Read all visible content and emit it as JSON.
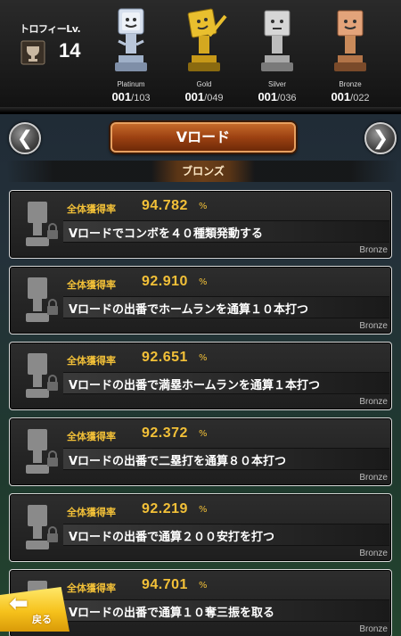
{
  "header": {
    "level_label": "トロフィーLv.",
    "level_value": "14",
    "trophies": [
      {
        "name": "Platinum",
        "got": "001",
        "total": "/103",
        "color": "#9fb3d6"
      },
      {
        "name": "Gold",
        "got": "001",
        "total": "/049",
        "color": "#e3b92a"
      },
      {
        "name": "Silver",
        "got": "001",
        "total": "/036",
        "color": "#c8c8c8"
      },
      {
        "name": "Bronze",
        "got": "001",
        "total": "/022",
        "color": "#c98a5a"
      }
    ]
  },
  "nav": {
    "prev_icon": "chevron-left-icon",
    "next_icon": "chevron-right-icon",
    "category_label": "Vロード",
    "section_label": "ブロンズ"
  },
  "achievements": [
    {
      "rate_label": "全体獲得率",
      "rate": "94.782",
      "unit": "%",
      "desc": "Vロードでコンボを４０種類発動する",
      "tier": "Bronze"
    },
    {
      "rate_label": "全体獲得率",
      "rate": "92.910",
      "unit": "%",
      "desc": "Vロードの出番でホームランを通算１０本打つ",
      "tier": "Bronze"
    },
    {
      "rate_label": "全体獲得率",
      "rate": "92.651",
      "unit": "%",
      "desc": "Vロードの出番で満塁ホームランを通算１本打つ",
      "tier": "Bronze"
    },
    {
      "rate_label": "全体獲得率",
      "rate": "92.372",
      "unit": "%",
      "desc": "Vロードの出番で二塁打を通算８０本打つ",
      "tier": "Bronze"
    },
    {
      "rate_label": "全体獲得率",
      "rate": "92.219",
      "unit": "%",
      "desc": "Vロードの出番で通算２００安打を打つ",
      "tier": "Bronze"
    },
    {
      "rate_label": "全体獲得率",
      "rate": "94.701",
      "unit": "%",
      "desc": "Vロードの出番で通算１０奪三振を取る",
      "tier": "Bronze"
    }
  ],
  "back": {
    "label": "戻る",
    "icon": "back-arrow-icon"
  }
}
